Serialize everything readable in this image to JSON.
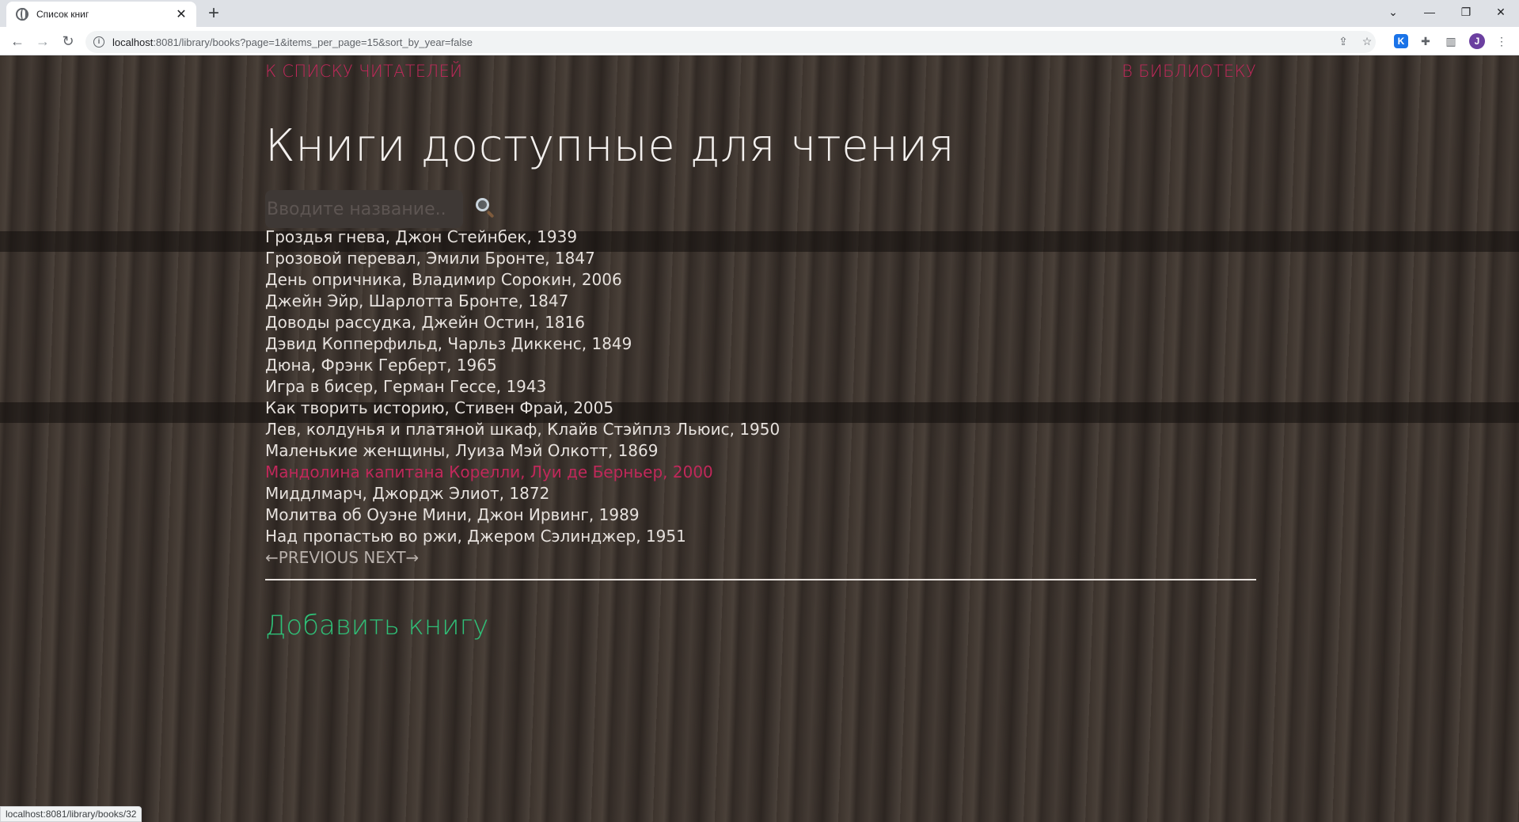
{
  "browser": {
    "tab_title": "Список книг",
    "url_host": "localhost",
    "url_rest": ":8081/library/books?page=1&items_per_page=15&sort_by_year=false",
    "avatar_letter": "J",
    "extension_letter": "K",
    "status_url": "localhost:8081/library/books/32"
  },
  "nav": {
    "readers_link": "К СПИСКУ ЧИТАТЕЛЕЙ",
    "library_link": "В БИБЛИОТЕКУ"
  },
  "heading": "Книги доступные для чтения",
  "search": {
    "placeholder": "Вводите название..",
    "value": ""
  },
  "books": [
    "Гроздья гнева, Джон Стейнбек, 1939",
    "Грозовой перевал, Эмили Бронте, 1847",
    "День опричника, Владимир Сорокин, 2006",
    "Джейн Эйр, Шарлотта Бронте, 1847",
    "Доводы рассудка, Джейн Остин, 1816",
    "Дэвид Копперфильд, Чарльз Диккенс, 1849",
    "Дюна, Фрэнк Герберт, 1965",
    "Игра в бисер, Герман Гессе, 1943",
    "Как творить историю, Стивен Фрай, 2005",
    "Лев, колдунья и платяной шкаф, Клайв Стэйплз Льюис, 1950",
    "Маленькие женщины, Луиза Мэй Олкотт, 1869",
    "Мандолина капитана Корелли, Луи де Берньер, 2000",
    "Миддлмарч, Джордж Элиот, 1872",
    "Молитва об Оуэне Мини, Джон Ирвинг, 1989",
    "Над пропастью во ржи, Джером Сэлинджер, 1951"
  ],
  "pager": {
    "previous": "←PREVIOUS",
    "next": "NEXT→"
  },
  "add_book": "Добавить книгу",
  "colors": {
    "link_accent": "#c0285a",
    "add_link": "#2fbf77",
    "text": "#e6e1dd"
  }
}
